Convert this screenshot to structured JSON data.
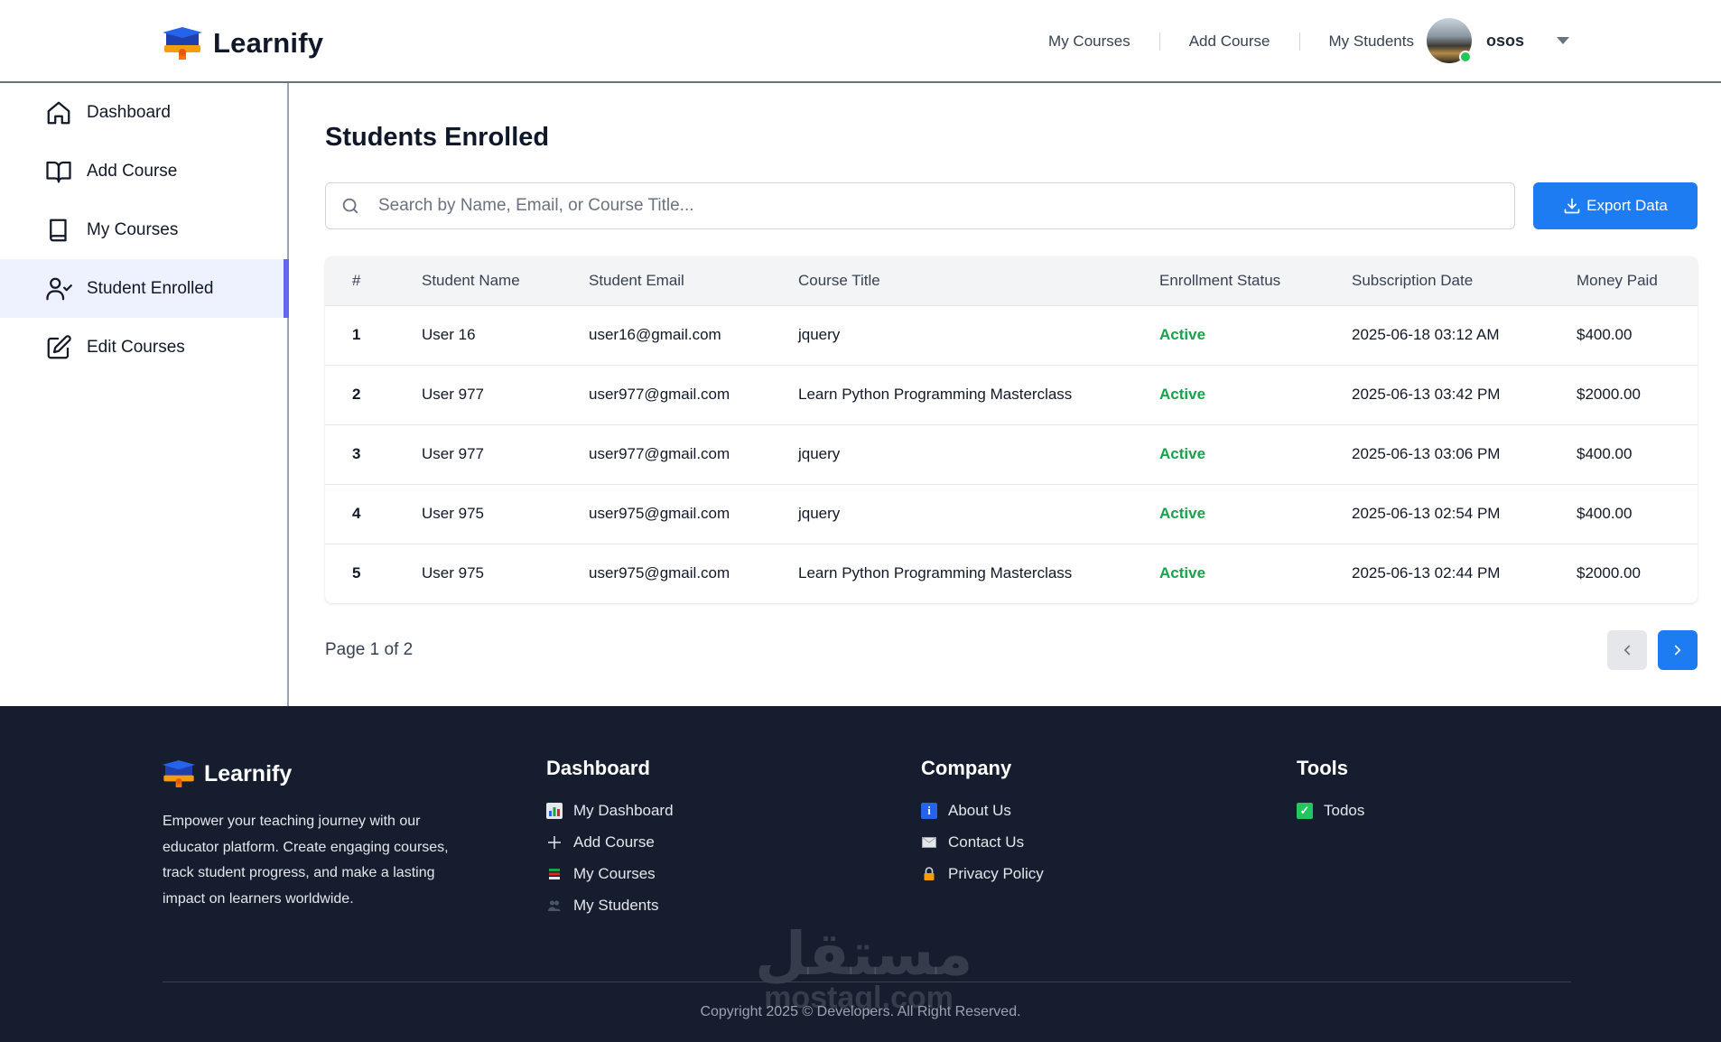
{
  "app": {
    "name": "Learnify"
  },
  "header": {
    "nav": [
      "My Courses",
      "Add Course",
      "My Students"
    ],
    "user_name": "osos"
  },
  "sidebar": {
    "items": [
      {
        "label": "Dashboard",
        "icon": "home-icon"
      },
      {
        "label": "Add Course",
        "icon": "open-book-icon"
      },
      {
        "label": "My Courses",
        "icon": "book-icon"
      },
      {
        "label": "Student Enrolled",
        "icon": "user-check-icon",
        "active": true
      },
      {
        "label": "Edit Courses",
        "icon": "edit-icon"
      }
    ]
  },
  "main": {
    "title": "Students Enrolled",
    "search_placeholder": "Search by Name, Email, or Course Title...",
    "export_label": "Export Data",
    "table": {
      "headers": [
        "#",
        "Student Name",
        "Student Email",
        "Course Title",
        "Enrollment Status",
        "Subscription Date",
        "Money Paid"
      ],
      "rows": [
        [
          "1",
          "User 16",
          "user16@gmail.com",
          "jquery",
          "Active",
          "2025-06-18 03:12 AM",
          "$400.00"
        ],
        [
          "2",
          "User 977",
          "user977@gmail.com",
          "Learn Python Programming Masterclass",
          "Active",
          "2025-06-13 03:42 PM",
          "$2000.00"
        ],
        [
          "3",
          "User 977",
          "user977@gmail.com",
          "jquery",
          "Active",
          "2025-06-13 03:06 PM",
          "$400.00"
        ],
        [
          "4",
          "User 975",
          "user975@gmail.com",
          "jquery",
          "Active",
          "2025-06-13 02:54 PM",
          "$400.00"
        ],
        [
          "5",
          "User 975",
          "user975@gmail.com",
          "Learn Python Programming Masterclass",
          "Active",
          "2025-06-13 02:44 PM",
          "$2000.00"
        ]
      ]
    },
    "page_info": "Page 1 of 2"
  },
  "footer": {
    "brand": "Learnify",
    "description": "Empower your teaching journey with our educator platform. Create engaging courses, track student progress, and make a lasting impact on learners worldwide.",
    "columns": [
      {
        "title": "Dashboard",
        "links": [
          {
            "label": "My Dashboard",
            "icon": "chart-icon"
          },
          {
            "label": "Add Course",
            "icon": "plus-icon"
          },
          {
            "label": "My Courses",
            "icon": "books-icon"
          },
          {
            "label": "My Students",
            "icon": "users-icon"
          }
        ]
      },
      {
        "title": "Company",
        "links": [
          {
            "label": "About Us",
            "icon": "info-icon"
          },
          {
            "label": "Contact Us",
            "icon": "envelope-icon"
          },
          {
            "label": "Privacy Policy",
            "icon": "lock-icon"
          }
        ]
      },
      {
        "title": "Tools",
        "links": [
          {
            "label": "Todos",
            "icon": "checkbox-icon"
          }
        ]
      }
    ],
    "copyright": "Copyright 2025 © Developers. All Right Reserved.",
    "watermark_ar": "مستقل",
    "watermark_lat": "mostaql.com"
  },
  "colors": {
    "accent": "#1d7cf2",
    "sidebar_active_bar": "#6366f1",
    "status_active": "#16a34a",
    "footer_bg": "#151d2e"
  }
}
